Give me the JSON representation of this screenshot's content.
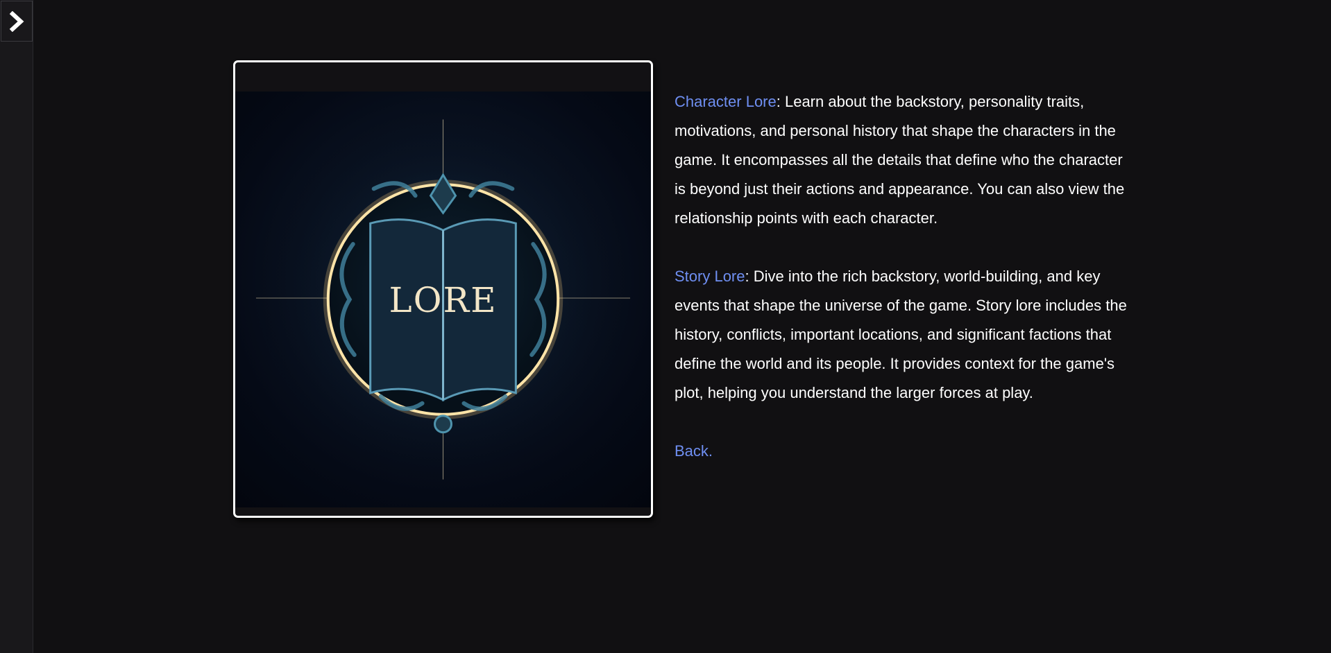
{
  "sidebar": {
    "toggle_icon": "chevron-right-icon"
  },
  "image": {
    "title_text": "LORE",
    "icon": "lore-book-emblem"
  },
  "character_lore": {
    "link_label": "Character Lore",
    "text": ": Learn about the backstory, personality traits, motivations, and personal history that shape the characters in the game. It encompasses all the details that define who the character is beyond just their actions and appearance. You can also view the relationship points with each character."
  },
  "story_lore": {
    "link_label": "Story Lore",
    "text": ": Dive into the rich backstory, world-building, and key events that shape the universe of the game. Story lore includes the history, conflicts, important locations, and significant factions that define the world and its people. It provides context for the game's plot, helping you understand the larger forces at play."
  },
  "back": {
    "label": "Back."
  },
  "colors": {
    "background": "#111012",
    "link": "#6f8ff2",
    "text": "#ffffff",
    "frame_border": "#ffffff"
  }
}
